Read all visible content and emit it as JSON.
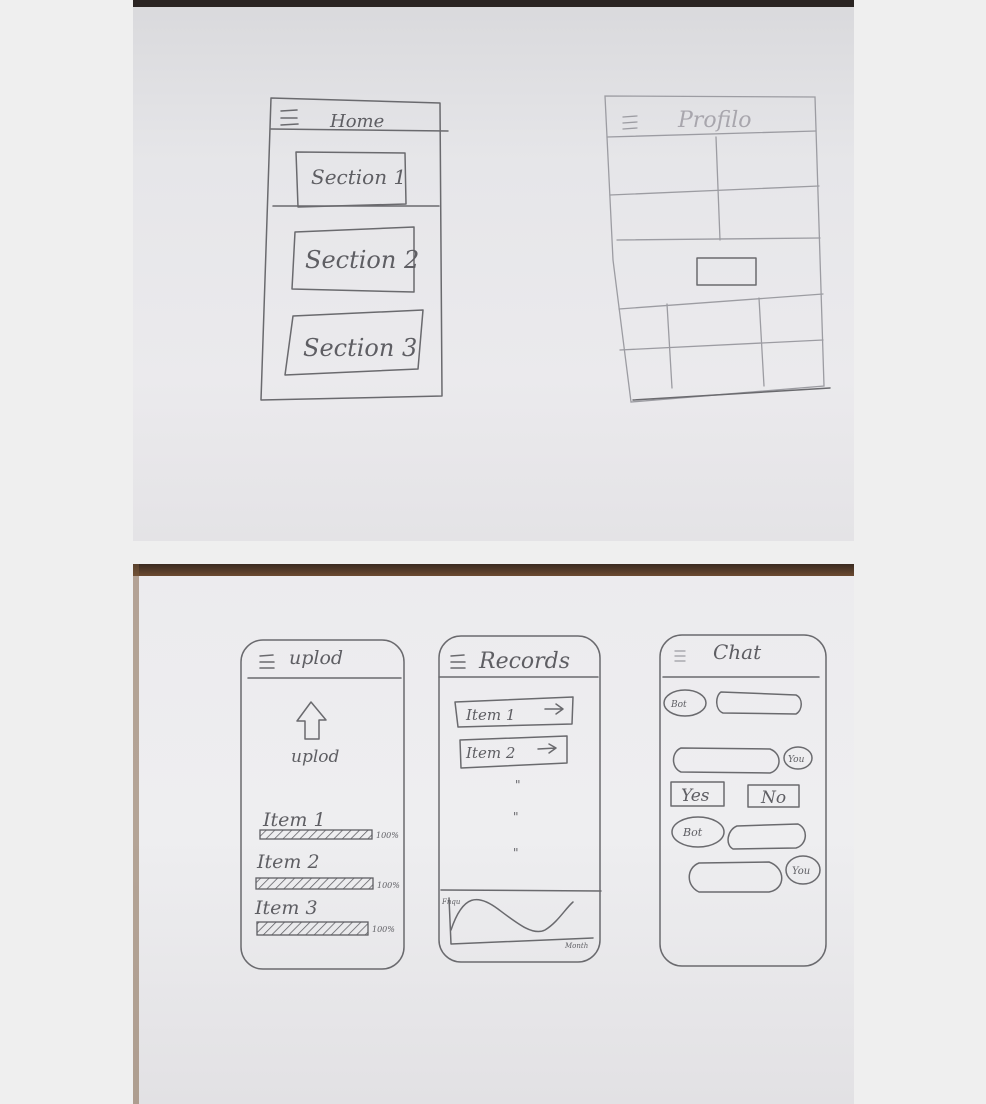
{
  "home": {
    "title": "Home",
    "sections": [
      "Section 1",
      "Section 2",
      "Section 3"
    ]
  },
  "profile": {
    "title": "Profilo"
  },
  "upload": {
    "title": "uplod",
    "upload_label": "uplod",
    "items": [
      {
        "label": "Item 1",
        "pct": "100%",
        "progress": 1.0
      },
      {
        "label": "Item 2",
        "pct": "100%",
        "progress": 1.0
      },
      {
        "label": "Item 3",
        "pct": "100%",
        "progress": 1.0
      }
    ]
  },
  "records": {
    "title": "Records",
    "items": [
      "Item 1",
      "Item 2"
    ],
    "ellipsis": [
      "\"",
      "\"",
      "\""
    ],
    "chart_y": "Fnqu",
    "chart_x": "Month"
  },
  "chat": {
    "title": "Chat",
    "bot": "Bot",
    "you": "You",
    "yes": "Yes",
    "no": "No"
  },
  "icons": [
    "hamburger-icon",
    "upload-arrow-icon",
    "arrow-right-icon"
  ]
}
